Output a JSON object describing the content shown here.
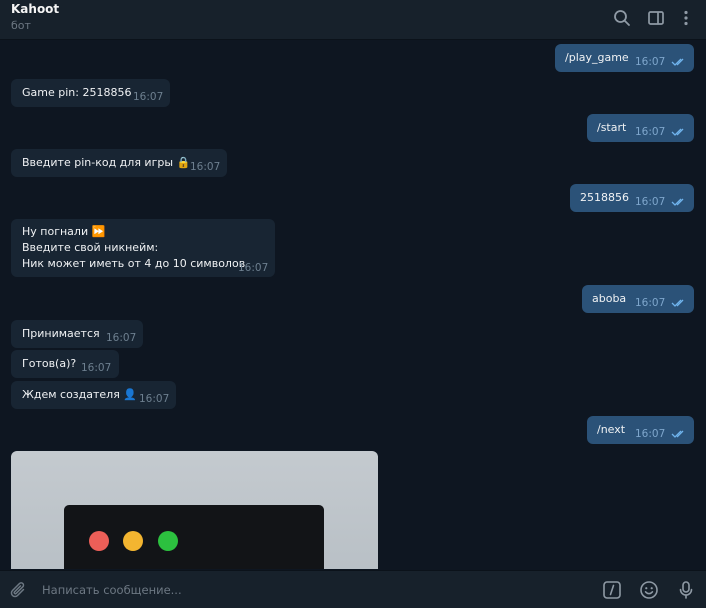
{
  "header": {
    "title": "Kahoot",
    "subtitle": "бот",
    "icons": [
      "search-icon",
      "sidebar-toggle-icon",
      "more-vertical-icon"
    ]
  },
  "messages": [
    {
      "dir": "out",
      "text": "/play_game",
      "time": "16:07"
    },
    {
      "dir": "in",
      "text": "Game pin: 2518856",
      "time": "16:07"
    },
    {
      "dir": "out",
      "text": "/start",
      "time": "16:07"
    },
    {
      "dir": "in",
      "text": "Введите pin-код для игры 🔒",
      "time": "16:07"
    },
    {
      "dir": "out",
      "text": "2518856",
      "time": "16:07"
    },
    {
      "dir": "in",
      "lines": [
        "Ну погнали ⏩",
        "Введите свой никнейм:",
        "Ник может иметь от 4 до 10 символов"
      ],
      "time": "16:07"
    },
    {
      "dir": "out",
      "text": "aboba",
      "time": "16:07"
    },
    {
      "dir": "in",
      "text": "Принимается",
      "time": "16:07"
    },
    {
      "dir": "in",
      "text": "Готов(а)?",
      "time": "16:07"
    },
    {
      "dir": "in",
      "text": "Ждем создателя 👤",
      "time": "16:07"
    },
    {
      "dir": "out",
      "text": "/next",
      "time": "16:07"
    }
  ],
  "photo": {
    "dot_colors": [
      "#ec5f58",
      "#f3b530",
      "#2cc13f"
    ],
    "background": "#c0c6cb"
  },
  "composer": {
    "placeholder": "Написать сообщение...",
    "icons": [
      "attach-icon",
      "commands-icon",
      "emoji-icon",
      "microphone-icon"
    ]
  },
  "colors": {
    "background": "#0e1621",
    "incoming_bubble": "#182533",
    "outgoing_bubble": "#2b5278",
    "read_check": "#6fb3ec"
  }
}
